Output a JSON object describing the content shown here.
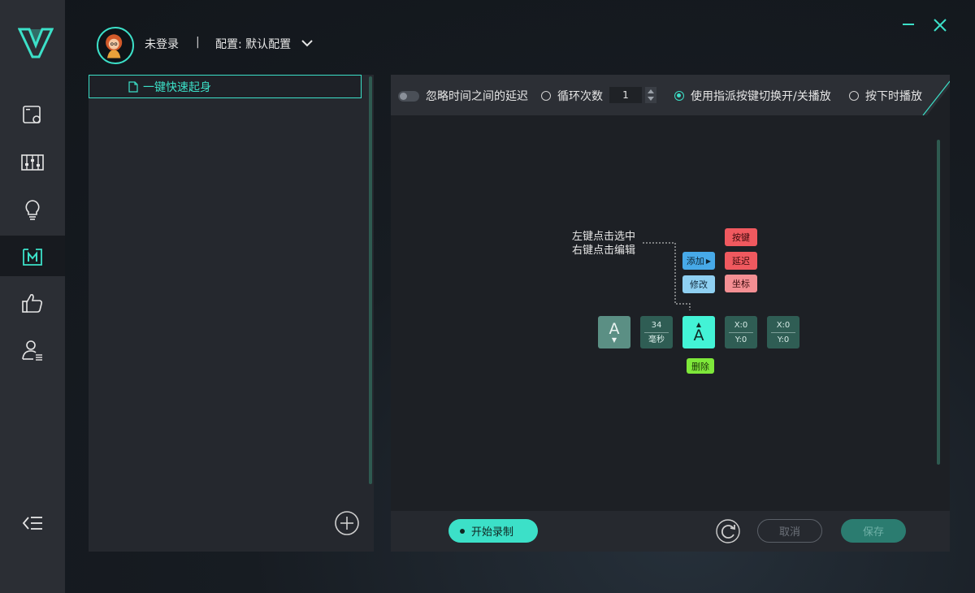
{
  "header": {
    "login_status": "未登录",
    "separator": "|",
    "config_label": "配置: 默认配置"
  },
  "nav": {
    "items": [
      {
        "icon": "screen-settings-icon"
      },
      {
        "icon": "sliders-icon"
      },
      {
        "icon": "lightbulb-icon"
      },
      {
        "icon": "macro-icon",
        "active": true
      },
      {
        "icon": "thumbs-up-icon"
      },
      {
        "icon": "user-list-icon"
      }
    ]
  },
  "macro_list": {
    "items": [
      {
        "label": "一键快速起身",
        "selected": true
      }
    ]
  },
  "toolbar": {
    "ignore_delay_label": "忽略时间之间的延迟",
    "loop_count_label": "循环次数",
    "loop_count_value": "1",
    "toggle_play_label": "使用指派按键切换开/关播放",
    "hold_play_label": "按下时播放"
  },
  "editor": {
    "hint_line1": "左键点击选中",
    "hint_line2": "右键点击编辑",
    "add_label": "添加",
    "modify_label": "修改",
    "key_label": "按键",
    "delay_label": "延迟",
    "coord_label": "坐标",
    "delete_label": "删除",
    "blocks": {
      "key_down": "A",
      "delay_value": "34",
      "delay_unit": "毫秒",
      "key_up": "A",
      "coord1_x": "X:0",
      "coord1_y": "Y:0",
      "coord2_x": "X:0",
      "coord2_y": "Y:0"
    }
  },
  "footer": {
    "record_label": "开始录制",
    "cancel_label": "取消",
    "save_label": "保存"
  },
  "colors": {
    "accent": "#3ce0c8",
    "nav_bg": "#2b2e34",
    "panel_bg": "#25282e"
  }
}
